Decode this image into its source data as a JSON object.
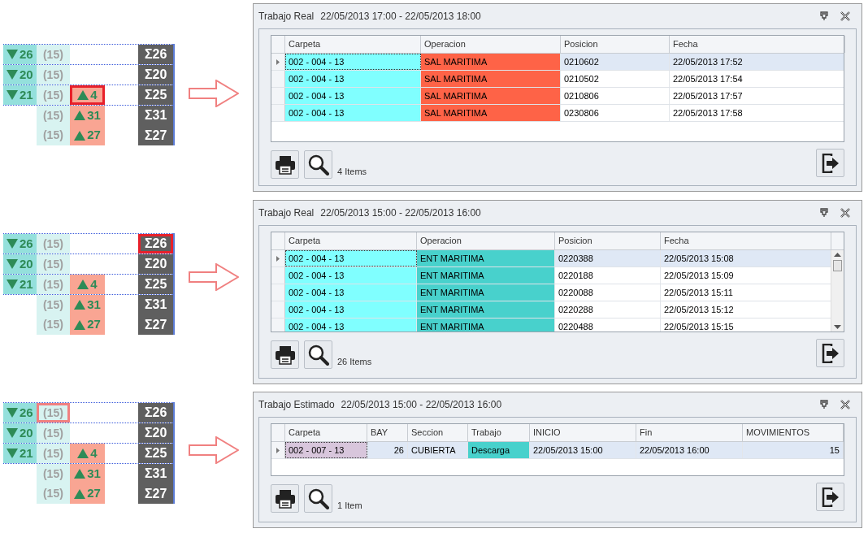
{
  "sections": [
    {
      "summary": {
        "color": "#e8202a",
        "rows": [
          {
            "cells": [
              {
                "kind": "down",
                "text": "26",
                "highlighted": false
              },
              {
                "kind": "count",
                "text": "(15)",
                "highlighted": false
              },
              {
                "kind": "total",
                "text": "Σ26",
                "highlighted": false
              }
            ]
          },
          {
            "cells": [
              {
                "kind": "down",
                "text": "20",
                "highlighted": false
              },
              {
                "kind": "count",
                "text": "(15)",
                "highlighted": false
              },
              {
                "kind": "total",
                "text": "Σ20",
                "highlighted": false
              }
            ]
          },
          {
            "cells": [
              {
                "kind": "down",
                "text": "21",
                "highlighted": false
              },
              {
                "kind": "count",
                "text": "(15)",
                "highlighted": false
              },
              {
                "kind": "up",
                "text": "4",
                "highlighted": true
              },
              {
                "kind": "total",
                "text": "Σ25",
                "highlighted": false
              }
            ]
          },
          {
            "cells": [
              {
                "kind": "count",
                "text": "(15)",
                "highlighted": false
              },
              {
                "kind": "up",
                "text": "31",
                "highlighted": false
              },
              {
                "kind": "total",
                "text": "Σ31",
                "highlighted": false
              }
            ]
          },
          {
            "cells": [
              {
                "kind": "count",
                "text": "(15)",
                "highlighted": false
              },
              {
                "kind": "up",
                "text": "27",
                "highlighted": false
              },
              {
                "kind": "total",
                "text": "Σ27",
                "highlighted": false
              }
            ]
          }
        ]
      },
      "dialog": {
        "title": "Trabajo Real",
        "period": "22/05/2013 17:00 - 22/05/2013 18:00",
        "scrollable": false,
        "columns": [
          {
            "label": "Carpeta",
            "kind": "text"
          },
          {
            "label": "Operacion",
            "kind": "text"
          },
          {
            "label": "Posicion",
            "kind": "text"
          },
          {
            "label": "Fecha",
            "kind": "text"
          }
        ],
        "rows": [
          {
            "selected": true,
            "cells": [
              {
                "text": "002 - 004 - 13",
                "color": "#80ffff"
              },
              {
                "text": "SAL MARITIMA",
                "color": "#fe6347"
              },
              {
                "text": "0210602"
              },
              {
                "text": "22/05/2013 17:52"
              }
            ]
          },
          {
            "selected": false,
            "cells": [
              {
                "text": "002 - 004 - 13",
                "color": "#80ffff"
              },
              {
                "text": "SAL MARITIMA",
                "color": "#fe6347"
              },
              {
                "text": "0210502"
              },
              {
                "text": "22/05/2013 17:54"
              }
            ]
          },
          {
            "selected": false,
            "cells": [
              {
                "text": "002 - 004 - 13",
                "color": "#80ffff"
              },
              {
                "text": "SAL MARITIMA",
                "color": "#fe6347"
              },
              {
                "text": "0210806"
              },
              {
                "text": "22/05/2013 17:57"
              }
            ]
          },
          {
            "selected": false,
            "cells": [
              {
                "text": "002 - 004 - 13",
                "color": "#80ffff"
              },
              {
                "text": "SAL MARITIMA",
                "color": "#fe6347"
              },
              {
                "text": "0230806"
              },
              {
                "text": "22/05/2013 17:58"
              }
            ]
          }
        ],
        "count": "4 Items"
      }
    },
    {
      "summary": {
        "color": "#e8202a",
        "rows": [
          {
            "cells": [
              {
                "kind": "down",
                "text": "26",
                "highlighted": false
              },
              {
                "kind": "count",
                "text": "(15)",
                "highlighted": false
              },
              {
                "kind": "total",
                "text": "Σ26",
                "highlighted": true
              }
            ]
          },
          {
            "cells": [
              {
                "kind": "down",
                "text": "20",
                "highlighted": false
              },
              {
                "kind": "count",
                "text": "(15)",
                "highlighted": false
              },
              {
                "kind": "total",
                "text": "Σ20",
                "highlighted": false
              }
            ]
          },
          {
            "cells": [
              {
                "kind": "down",
                "text": "21",
                "highlighted": false
              },
              {
                "kind": "count",
                "text": "(15)",
                "highlighted": false
              },
              {
                "kind": "up",
                "text": "4",
                "highlighted": false
              },
              {
                "kind": "total",
                "text": "Σ25",
                "highlighted": false
              }
            ]
          },
          {
            "cells": [
              {
                "kind": "count",
                "text": "(15)",
                "highlighted": false
              },
              {
                "kind": "up",
                "text": "31",
                "highlighted": false
              },
              {
                "kind": "total",
                "text": "Σ31",
                "highlighted": false
              }
            ]
          },
          {
            "cells": [
              {
                "kind": "count",
                "text": "(15)",
                "highlighted": false
              },
              {
                "kind": "up",
                "text": "27",
                "highlighted": false
              },
              {
                "kind": "total",
                "text": "Σ27",
                "highlighted": false
              }
            ]
          }
        ]
      },
      "dialog": {
        "title": "Trabajo Real",
        "period": "22/05/2013 15:00 - 22/05/2013 16:00",
        "scrollable": true,
        "columns": [
          {
            "label": "Carpeta",
            "kind": "text"
          },
          {
            "label": "Operacion",
            "kind": "text"
          },
          {
            "label": "Posicion",
            "kind": "text"
          },
          {
            "label": "Fecha",
            "kind": "text"
          }
        ],
        "rows": [
          {
            "selected": true,
            "cells": [
              {
                "text": "002 - 004 - 13",
                "color": "#80ffff"
              },
              {
                "text": "ENT MARITIMA",
                "color": "#48d1cc"
              },
              {
                "text": "0220388"
              },
              {
                "text": "22/05/2013 15:08"
              }
            ]
          },
          {
            "selected": false,
            "cells": [
              {
                "text": "002 - 004 - 13",
                "color": "#80ffff"
              },
              {
                "text": "ENT MARITIMA",
                "color": "#48d1cc"
              },
              {
                "text": "0220188"
              },
              {
                "text": "22/05/2013 15:09"
              }
            ]
          },
          {
            "selected": false,
            "cells": [
              {
                "text": "002 - 004 - 13",
                "color": "#80ffff"
              },
              {
                "text": "ENT MARITIMA",
                "color": "#48d1cc"
              },
              {
                "text": "0220088"
              },
              {
                "text": "22/05/2013 15:11"
              }
            ]
          },
          {
            "selected": false,
            "cells": [
              {
                "text": "002 - 004 - 13",
                "color": "#80ffff"
              },
              {
                "text": "ENT MARITIMA",
                "color": "#48d1cc"
              },
              {
                "text": "0220288"
              },
              {
                "text": "22/05/2013 15:12"
              }
            ]
          },
          {
            "selected": false,
            "cells": [
              {
                "text": "002 - 004 - 13",
                "color": "#80ffff"
              },
              {
                "text": "ENT MARITIMA",
                "color": "#48d1cc"
              },
              {
                "text": "0220488"
              },
              {
                "text": "22/05/2013 15:15"
              }
            ]
          }
        ],
        "count": "26 Items"
      }
    },
    {
      "summary": {
        "color": "#f08080",
        "rows": [
          {
            "cells": [
              {
                "kind": "down",
                "text": "26",
                "highlighted": false
              },
              {
                "kind": "count",
                "text": "(15)",
                "highlighted": true
              },
              {
                "kind": "total",
                "text": "Σ26",
                "highlighted": false
              }
            ]
          },
          {
            "cells": [
              {
                "kind": "down",
                "text": "20",
                "highlighted": false
              },
              {
                "kind": "count",
                "text": "(15)",
                "highlighted": false
              },
              {
                "kind": "total",
                "text": "Σ20",
                "highlighted": false
              }
            ]
          },
          {
            "cells": [
              {
                "kind": "down",
                "text": "21",
                "highlighted": false
              },
              {
                "kind": "count",
                "text": "(15)",
                "highlighted": false
              },
              {
                "kind": "up",
                "text": "4",
                "highlighted": false
              },
              {
                "kind": "total",
                "text": "Σ25",
                "highlighted": false
              }
            ]
          },
          {
            "cells": [
              {
                "kind": "count",
                "text": "(15)",
                "highlighted": false
              },
              {
                "kind": "up",
                "text": "31",
                "highlighted": false
              },
              {
                "kind": "total",
                "text": "Σ31",
                "highlighted": false
              }
            ]
          },
          {
            "cells": [
              {
                "kind": "count",
                "text": "(15)",
                "highlighted": false
              },
              {
                "kind": "up",
                "text": "27",
                "highlighted": false
              },
              {
                "kind": "total",
                "text": "Σ27",
                "highlighted": false
              }
            ]
          }
        ]
      },
      "dialog": {
        "title": "Trabajo Estimado",
        "period": "22/05/2013 15:00 - 22/05/2013 16:00",
        "scrollable": false,
        "columns": [
          {
            "label": "Carpeta",
            "kind": "text"
          },
          {
            "label": "BAY",
            "kind": "number"
          },
          {
            "label": "Seccion",
            "kind": "text"
          },
          {
            "label": "Trabajo",
            "kind": "text"
          },
          {
            "label": "INICIO",
            "kind": "text"
          },
          {
            "label": "Fin",
            "kind": "text"
          },
          {
            "label": "MOVIMIENTOS",
            "kind": "number"
          }
        ],
        "rows": [
          {
            "selected": true,
            "cells": [
              {
                "text": "002 - 007 - 13",
                "color": "#d8c6dc"
              },
              {
                "text": "26"
              },
              {
                "text": "CUBIERTA"
              },
              {
                "text": "Descarga",
                "color": "#48d1cc"
              },
              {
                "text": "22/05/2013 15:00"
              },
              {
                "text": "22/05/2013 16:00"
              },
              {
                "text": "15"
              }
            ]
          }
        ],
        "count": "1 Item"
      }
    }
  ]
}
